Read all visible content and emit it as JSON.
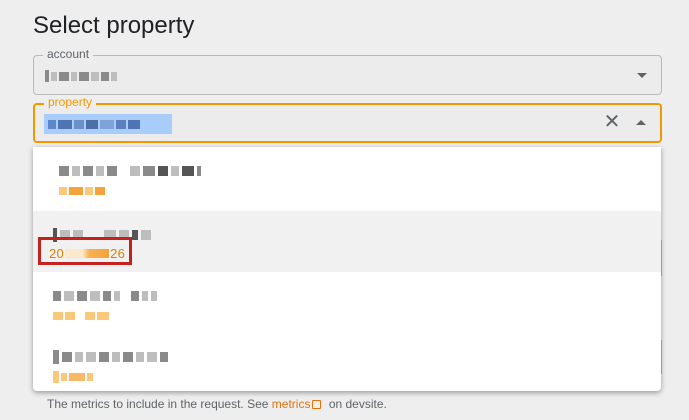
{
  "page": {
    "title": "Select property"
  },
  "account_field": {
    "label": "account"
  },
  "property_field": {
    "label": "property"
  },
  "dropdown": {
    "selected_option_id_visible_prefix": "20",
    "selected_option_id_visible_suffix": "26"
  },
  "footer": {
    "text_before": "The metrics to include in the request. See",
    "link": "metrics",
    "text_after": "on devsite."
  },
  "colors": {
    "accent": "#f29900",
    "link": "#e8710a",
    "highlight": "#c5221f"
  }
}
